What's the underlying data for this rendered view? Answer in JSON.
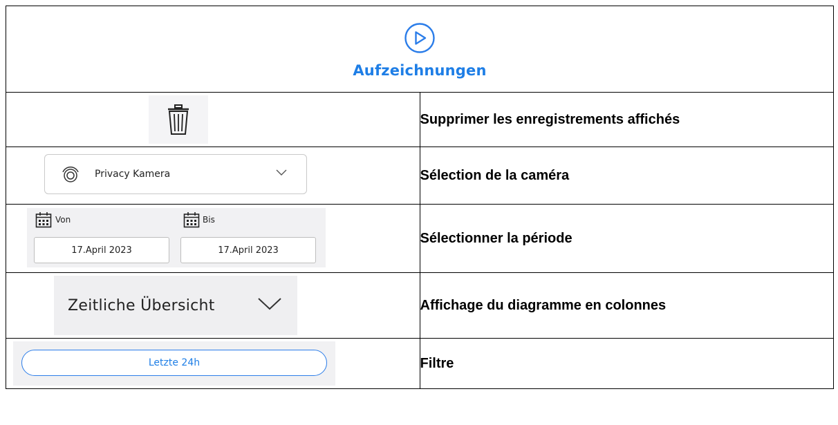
{
  "header": {
    "title": "Aufzeichnungen",
    "icon": "play-circle-icon",
    "accent": "#1e7ee6"
  },
  "rows": [
    {
      "description": "Supprimer les enregistrements affichés",
      "control": {
        "icon": "trash-icon"
      }
    },
    {
      "description": "Sélection de la caméra",
      "control": {
        "value": "Privacy Kamera",
        "icon": "camera-icon"
      }
    },
    {
      "description": "Sélectionner la période",
      "control": {
        "from_label": "Von",
        "from_value": "17.April 2023",
        "to_label": "Bis",
        "to_value": "17.April 2023",
        "icon": "calendar-icon"
      }
    },
    {
      "description": "Affichage du diagramme en colonnes",
      "control": {
        "label": "Zeitliche Übersicht",
        "icon": "chevron-down-icon"
      }
    },
    {
      "description": "Filtre",
      "control": {
        "label": "Letzte 24h"
      }
    }
  ]
}
